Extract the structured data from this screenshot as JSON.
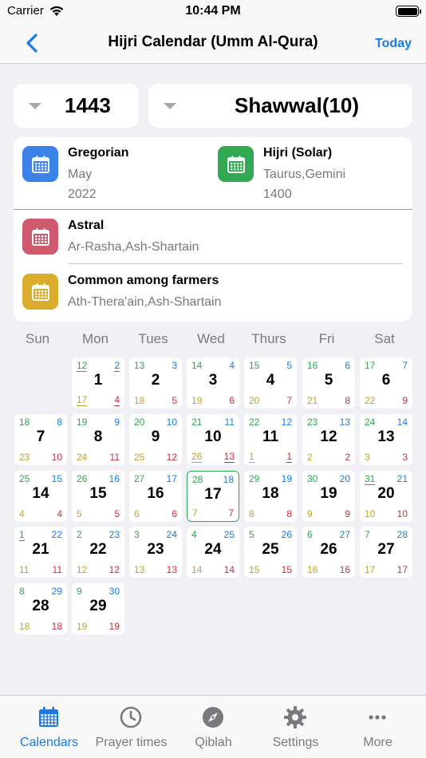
{
  "status_bar": {
    "carrier": "Carrier",
    "time": "10:44 PM"
  },
  "navbar": {
    "title": "Hijri Calendar (Umm Al-Qura)",
    "today_label": "Today"
  },
  "pickers": {
    "year": "1443",
    "month": "Shawwal(10)"
  },
  "info": {
    "gregorian": {
      "label": "Gregorian",
      "line1": "May",
      "line2": "2022",
      "color": "#3b82e8"
    },
    "hijri_solar": {
      "label": "Hijri (Solar)",
      "line1": "Taurus,Gemini",
      "line2": "1400",
      "color": "#33a852"
    },
    "astral": {
      "label": "Astral",
      "line1": "Ar-Rasha,Ash-Shartain",
      "color": "#cf5a6e"
    },
    "farmers": {
      "label": "Common among farmers",
      "line1": "Ath-Thera'ain,Ash-Shartain",
      "color": "#dbab2b"
    }
  },
  "weekdays": [
    "Sun",
    "Mon",
    "Tues",
    "Wed",
    "Thurs",
    "Fri",
    "Sat"
  ],
  "days": [
    {
      "n": "1",
      "tl": "12",
      "tr": "2",
      "bl": "17",
      "br": "4",
      "u": "tl,tr,bl,br"
    },
    {
      "n": "2",
      "tl": "13",
      "tr": "3",
      "bl": "18",
      "br": "5"
    },
    {
      "n": "3",
      "tl": "14",
      "tr": "4",
      "bl": "19",
      "br": "6"
    },
    {
      "n": "4",
      "tl": "15",
      "tr": "5",
      "bl": "20",
      "br": "7"
    },
    {
      "n": "5",
      "tl": "16",
      "tr": "6",
      "bl": "21",
      "br": "8"
    },
    {
      "n": "6",
      "tl": "17",
      "tr": "7",
      "bl": "22",
      "br": "9"
    },
    {
      "n": "7",
      "tl": "18",
      "tr": "8",
      "bl": "23",
      "br": "10"
    },
    {
      "n": "8",
      "tl": "19",
      "tr": "9",
      "bl": "24",
      "br": "11"
    },
    {
      "n": "9",
      "tl": "20",
      "tr": "10",
      "bl": "25",
      "br": "12"
    },
    {
      "n": "10",
      "tl": "21",
      "tr": "11",
      "bl": "26",
      "br": "13",
      "u": "bl,br"
    },
    {
      "n": "11",
      "tl": "22",
      "tr": "12",
      "bl": "1",
      "br": "1",
      "u": "bl,br"
    },
    {
      "n": "12",
      "tl": "23",
      "tr": "13",
      "bl": "2",
      "br": "2"
    },
    {
      "n": "13",
      "tl": "24",
      "tr": "14",
      "bl": "3",
      "br": "3"
    },
    {
      "n": "14",
      "tl": "25",
      "tr": "15",
      "bl": "4",
      "br": "4"
    },
    {
      "n": "15",
      "tl": "26",
      "tr": "16",
      "bl": "5",
      "br": "5"
    },
    {
      "n": "16",
      "tl": "27",
      "tr": "17",
      "bl": "6",
      "br": "6"
    },
    {
      "n": "17",
      "tl": "28",
      "tr": "18",
      "bl": "7",
      "br": "7",
      "today": true
    },
    {
      "n": "18",
      "tl": "29",
      "tr": "19",
      "bl": "8",
      "br": "8"
    },
    {
      "n": "19",
      "tl": "30",
      "tr": "20",
      "bl": "9",
      "br": "9"
    },
    {
      "n": "20",
      "tl": "31",
      "tr": "21",
      "bl": "10",
      "br": "10",
      "u": "tl"
    },
    {
      "n": "21",
      "tl": "1",
      "tr": "22",
      "bl": "11",
      "br": "11",
      "u": "tl"
    },
    {
      "n": "22",
      "tl": "2",
      "tr": "23",
      "bl": "12",
      "br": "12"
    },
    {
      "n": "23",
      "tl": "3",
      "tr": "24",
      "bl": "13",
      "br": "13"
    },
    {
      "n": "24",
      "tl": "4",
      "tr": "25",
      "bl": "14",
      "br": "14"
    },
    {
      "n": "25",
      "tl": "5",
      "tr": "26",
      "bl": "15",
      "br": "15"
    },
    {
      "n": "26",
      "tl": "6",
      "tr": "27",
      "bl": "16",
      "br": "16"
    },
    {
      "n": "27",
      "tl": "7",
      "tr": "28",
      "bl": "17",
      "br": "17"
    },
    {
      "n": "28",
      "tl": "8",
      "tr": "29",
      "bl": "18",
      "br": "18"
    },
    {
      "n": "29",
      "tl": "9",
      "tr": "30",
      "bl": "19",
      "br": "19"
    }
  ],
  "first_weekday": 1,
  "tabs": [
    {
      "label": "Calendars",
      "icon": "calendar-icon",
      "active": true
    },
    {
      "label": "Prayer times",
      "icon": "clock-icon"
    },
    {
      "label": "Qiblah",
      "icon": "compass-icon"
    },
    {
      "label": "Settings",
      "icon": "gear-icon"
    },
    {
      "label": "More",
      "icon": "more-icon"
    }
  ],
  "colors": {
    "accent": "#1a7ae6",
    "green": "#2fa84f",
    "gold": "#c9a227",
    "red": "#c8303e"
  }
}
